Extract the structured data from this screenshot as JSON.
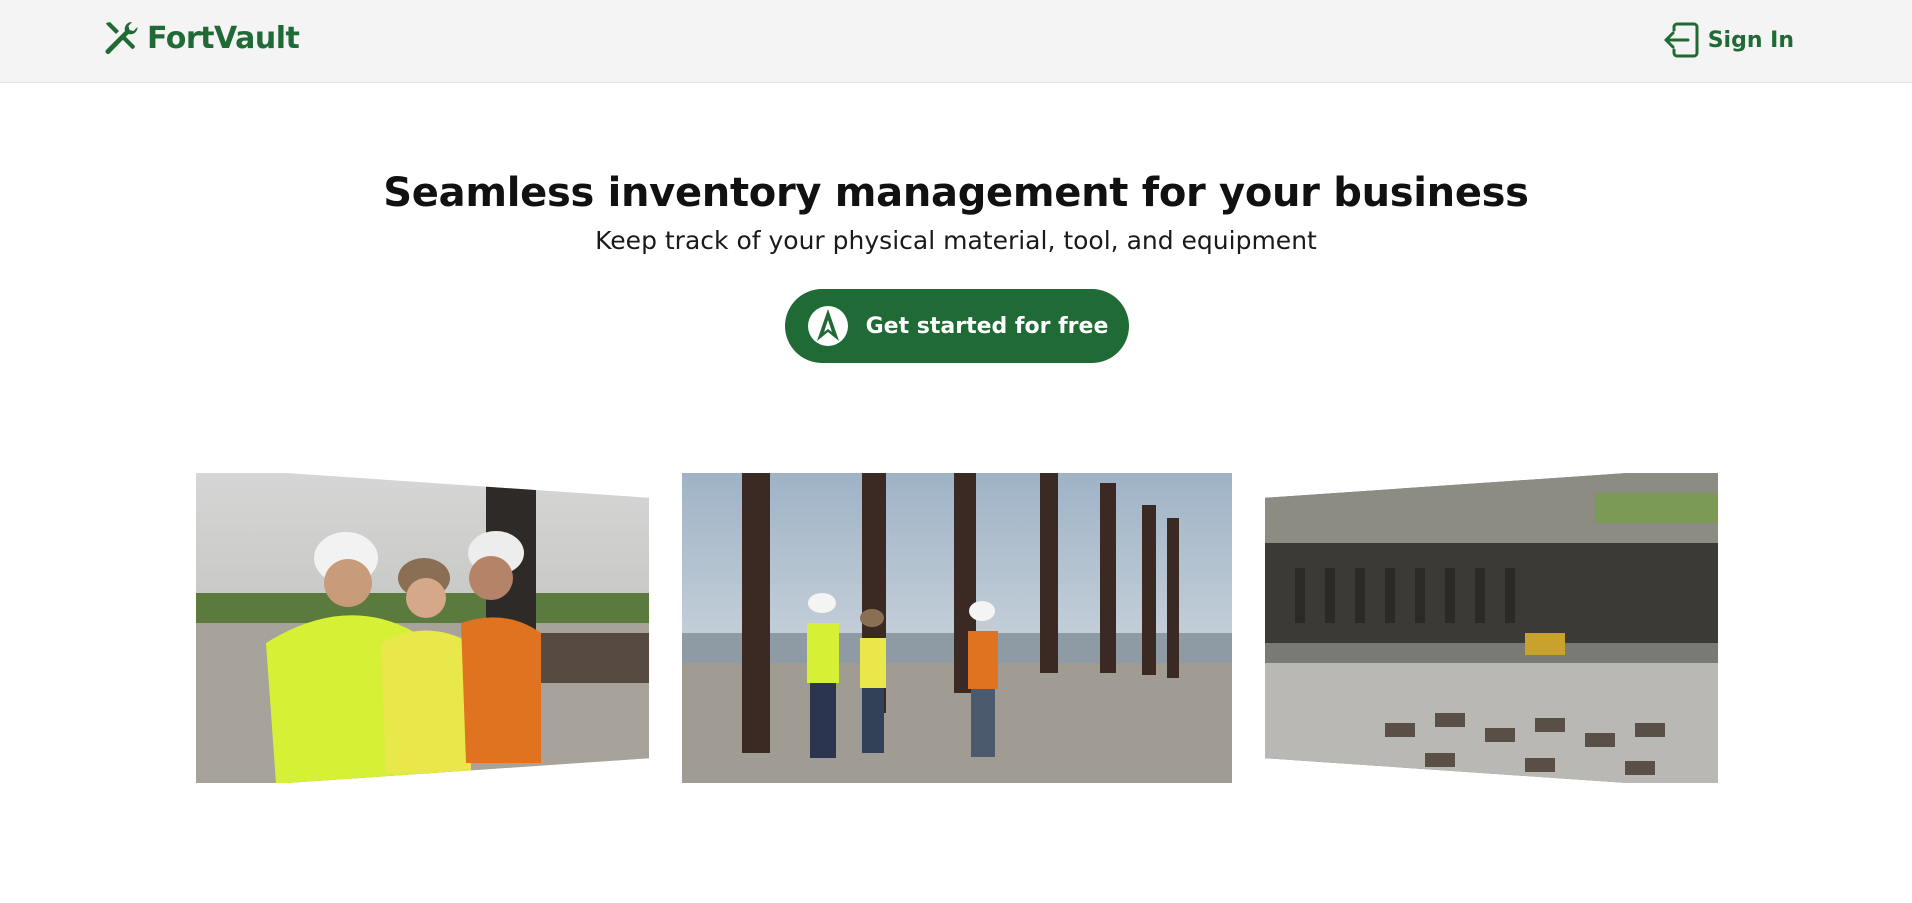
{
  "header": {
    "brand_name": "FortVault",
    "brand_icon": "tools-icon",
    "signin_label": "Sign In",
    "signin_icon": "sign-in-icon"
  },
  "hero": {
    "title": "Seamless inventory management for your business",
    "subtitle": "Keep track of your physical material, tool, and equipment",
    "cta_label": "Get started for free",
    "cta_icon": "star-trek-delta-icon"
  },
  "gallery": {
    "items": [
      {
        "name": "workers-conversation-photo"
      },
      {
        "name": "pier-pilings-photo"
      },
      {
        "name": "construction-site-aerial-photo"
      }
    ]
  },
  "colors": {
    "brand_green": "#1f6a35",
    "header_bg": "#f4f4f4",
    "page_bg": "#ffffff"
  }
}
